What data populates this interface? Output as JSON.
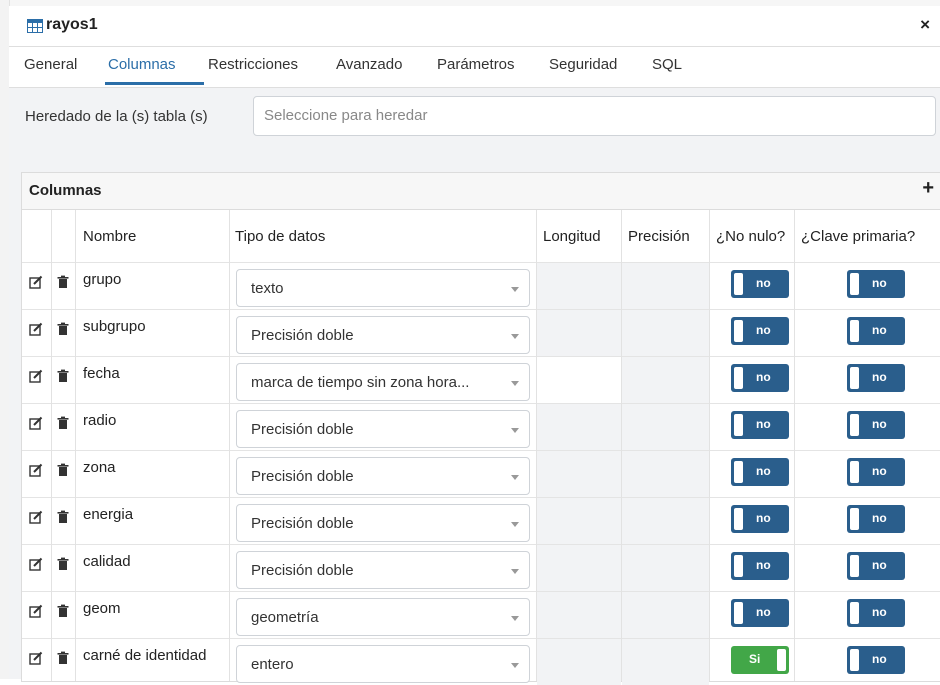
{
  "window": {
    "title": "rayos1",
    "icon": "table-icon",
    "close": "×"
  },
  "tabs": [
    "General",
    "Columnas",
    "Restricciones",
    "Avanzado",
    "Parámetros",
    "Seguridad",
    "SQL"
  ],
  "active_tab": "Columnas",
  "inherit": {
    "label": "Heredado de la (s) tabla (s)",
    "placeholder": "Seleccione para heredar"
  },
  "grid": {
    "title": "Columnas",
    "add": "+",
    "headers": {
      "name": "Nombre",
      "type": "Tipo de datos",
      "length": "Longitud",
      "precision": "Precisión",
      "not_null": "¿No nulo?",
      "pk": "¿Clave primaria?"
    },
    "rows": [
      {
        "name": "grupo",
        "type": "texto",
        "not_null": "no",
        "pk": "no"
      },
      {
        "name": "subgrupo",
        "type": "Precisión doble",
        "not_null": "no",
        "pk": "no"
      },
      {
        "name": "fecha",
        "type": "marca de tiempo sin zona hora...",
        "not_null": "no",
        "pk": "no"
      },
      {
        "name": "radio",
        "type": "Precisión doble",
        "not_null": "no",
        "pk": "no"
      },
      {
        "name": "zona",
        "type": "Precisión doble",
        "not_null": "no",
        "pk": "no"
      },
      {
        "name": "energia",
        "type": "Precisión doble",
        "not_null": "no",
        "pk": "no"
      },
      {
        "name": "calidad",
        "type": "Precisión doble",
        "not_null": "no",
        "pk": "no"
      },
      {
        "name": "geom",
        "type": "geometría",
        "not_null": "no",
        "pk": "no"
      },
      {
        "name": "carné de identidad",
        "type": "entero",
        "not_null": "Si",
        "pk": "no"
      }
    ]
  },
  "colors": {
    "accent": "#2b6ea8",
    "toggle_off": "#2a5e8c",
    "toggle_on": "#42a748"
  }
}
